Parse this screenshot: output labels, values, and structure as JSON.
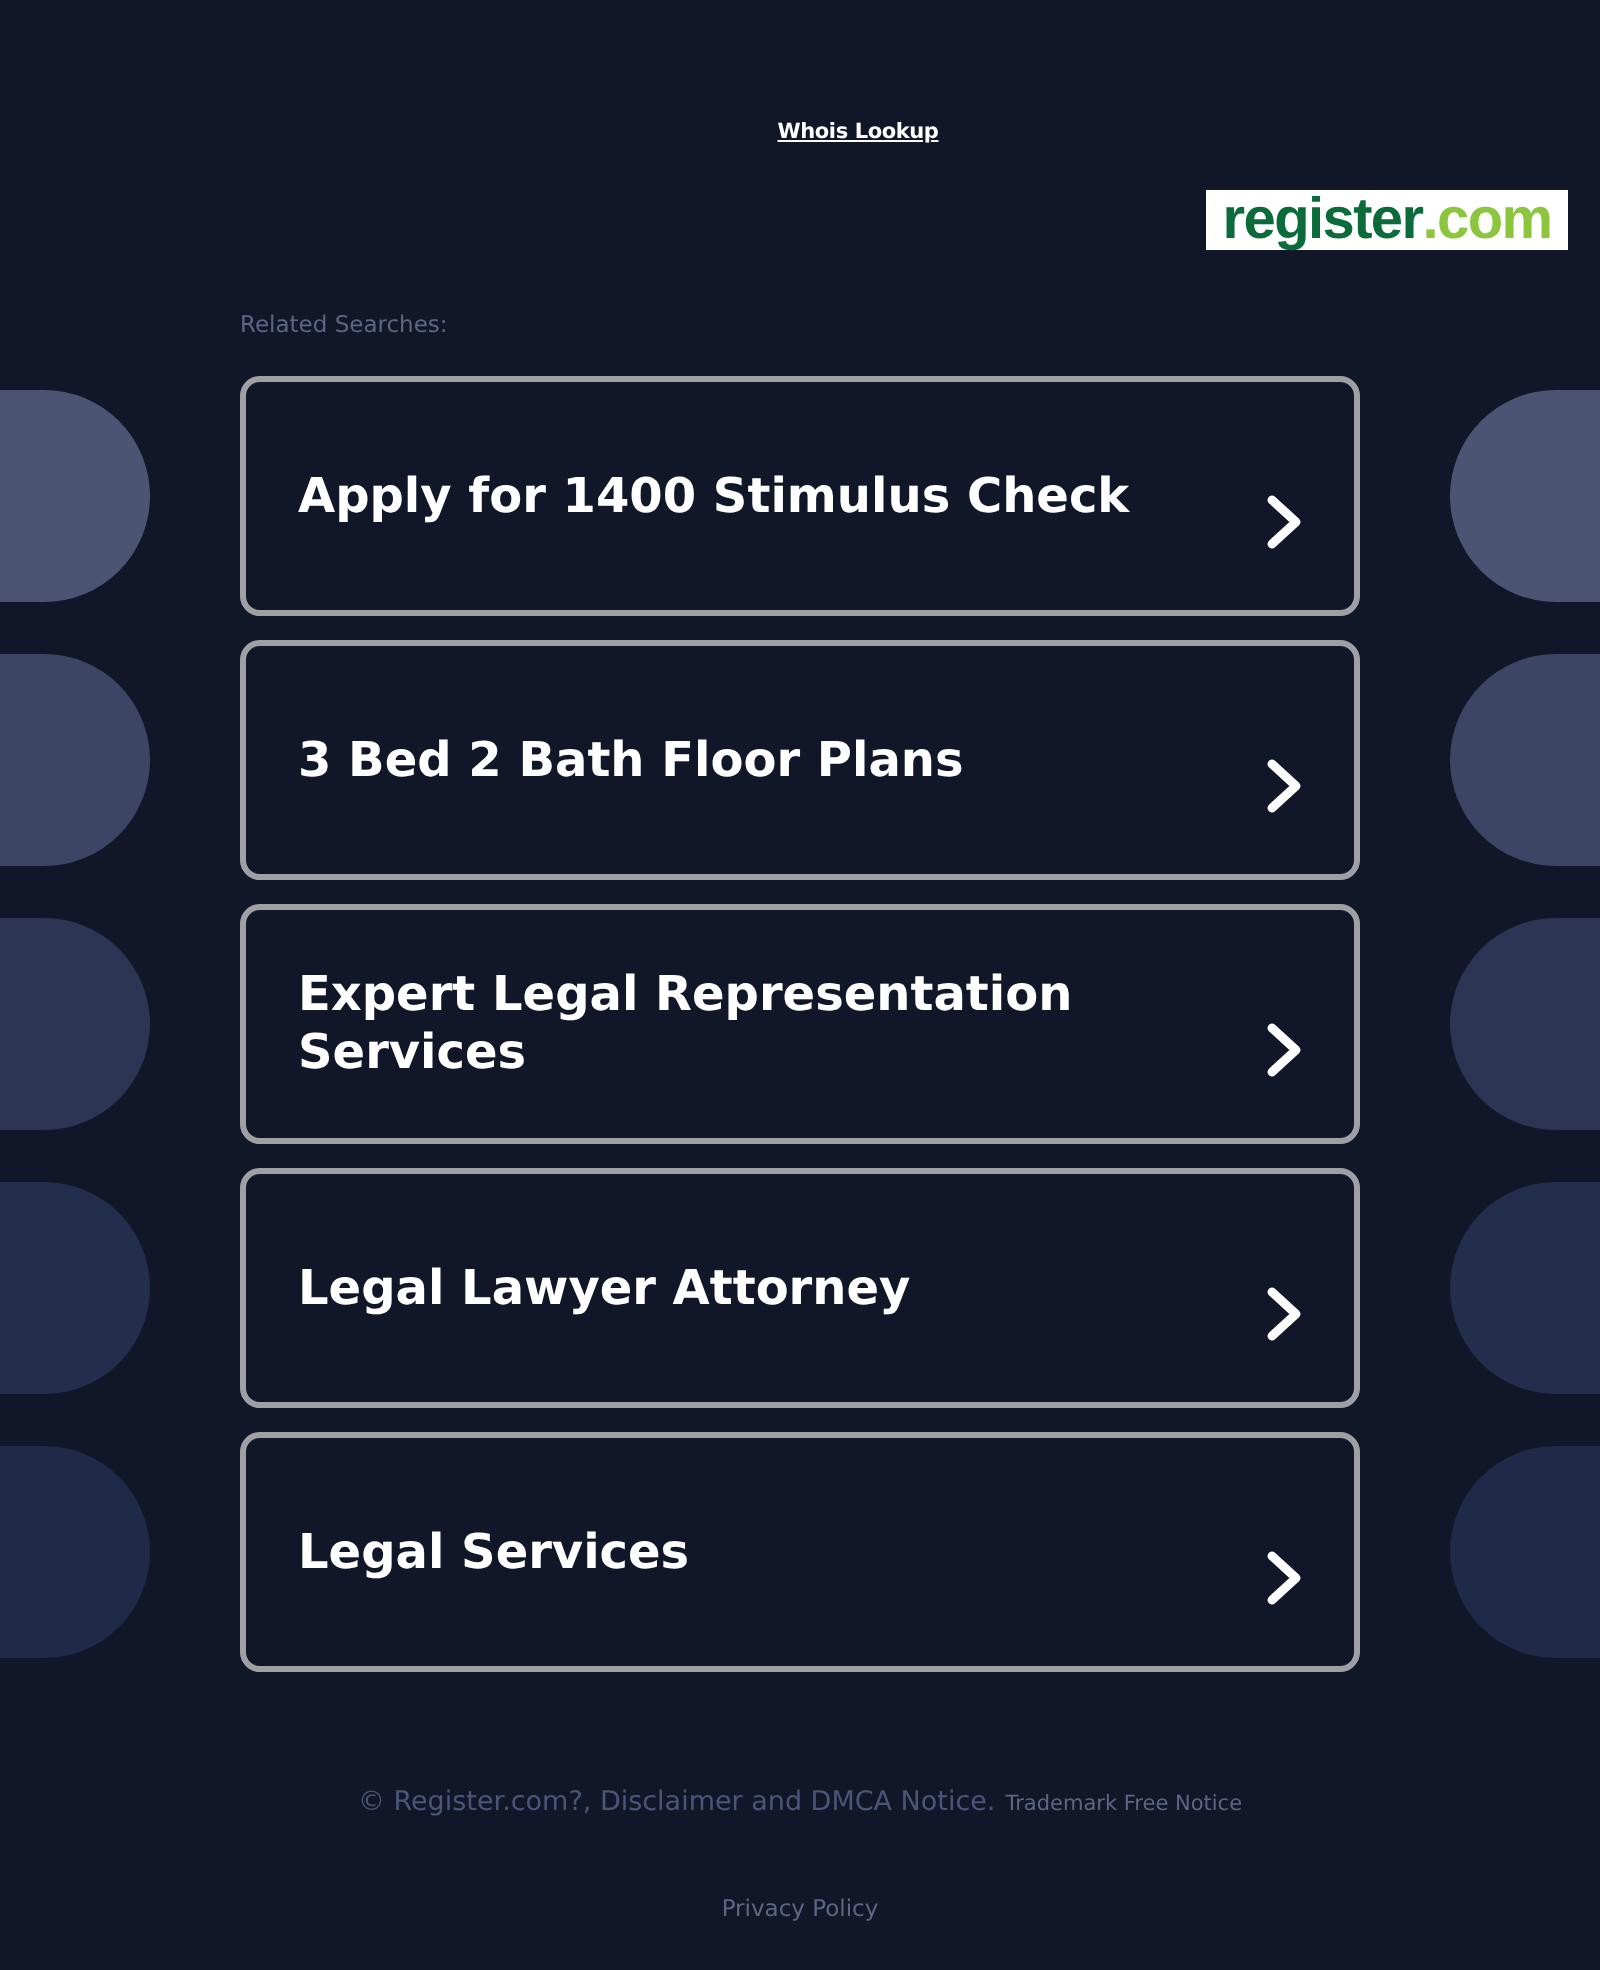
{
  "header": {
    "whois_link": "Whois Lookup"
  },
  "logo": {
    "name": "register",
    "suffix": ".com"
  },
  "related": {
    "heading": "Related Searches:",
    "items": [
      "Apply for 1400 Stimulus Check",
      "3 Bed 2 Bath Floor Plans",
      "Expert Legal Representation Services",
      "Legal Lawyer Attorney",
      "Legal Services"
    ]
  },
  "footer": {
    "copyright": "© Register.com?, Disclaimer and DMCA Notice.",
    "trademark_link": "Trademark Free Notice",
    "privacy_link": "Privacy Policy"
  }
}
